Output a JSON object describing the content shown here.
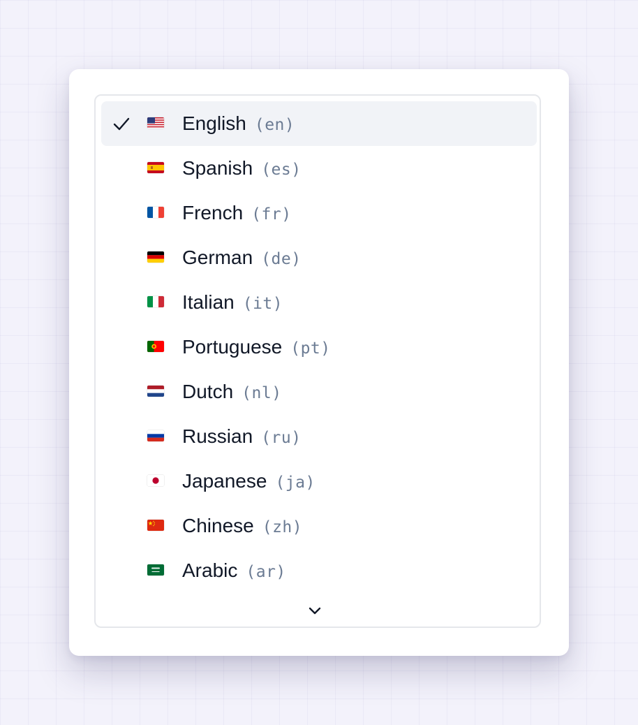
{
  "languages": {
    "items": [
      {
        "name": "English",
        "code": "(en)",
        "flag": "us-flag-icon",
        "selected": true
      },
      {
        "name": "Spanish",
        "code": "(es)",
        "flag": "es-flag-icon",
        "selected": false
      },
      {
        "name": "French",
        "code": "(fr)",
        "flag": "fr-flag-icon",
        "selected": false
      },
      {
        "name": "German",
        "code": "(de)",
        "flag": "de-flag-icon",
        "selected": false
      },
      {
        "name": "Italian",
        "code": "(it)",
        "flag": "it-flag-icon",
        "selected": false
      },
      {
        "name": "Portuguese",
        "code": "(pt)",
        "flag": "pt-flag-icon",
        "selected": false
      },
      {
        "name": "Dutch",
        "code": "(nl)",
        "flag": "nl-flag-icon",
        "selected": false
      },
      {
        "name": "Russian",
        "code": "(ru)",
        "flag": "ru-flag-icon",
        "selected": false
      },
      {
        "name": "Japanese",
        "code": "(ja)",
        "flag": "jp-flag-icon",
        "selected": false
      },
      {
        "name": "Chinese",
        "code": "(zh)",
        "flag": "cn-flag-icon",
        "selected": false
      },
      {
        "name": "Arabic",
        "code": "(ar)",
        "flag": "sa-flag-icon",
        "selected": false
      }
    ],
    "scroll_indicator_icon": "chevron-down-icon",
    "selected_icon": "checkmark-icon"
  },
  "colors": {
    "selected_row_bg": "#f1f3f7",
    "text": "#111827",
    "code_text": "#6b7b93",
    "border": "#e5e7eb"
  }
}
